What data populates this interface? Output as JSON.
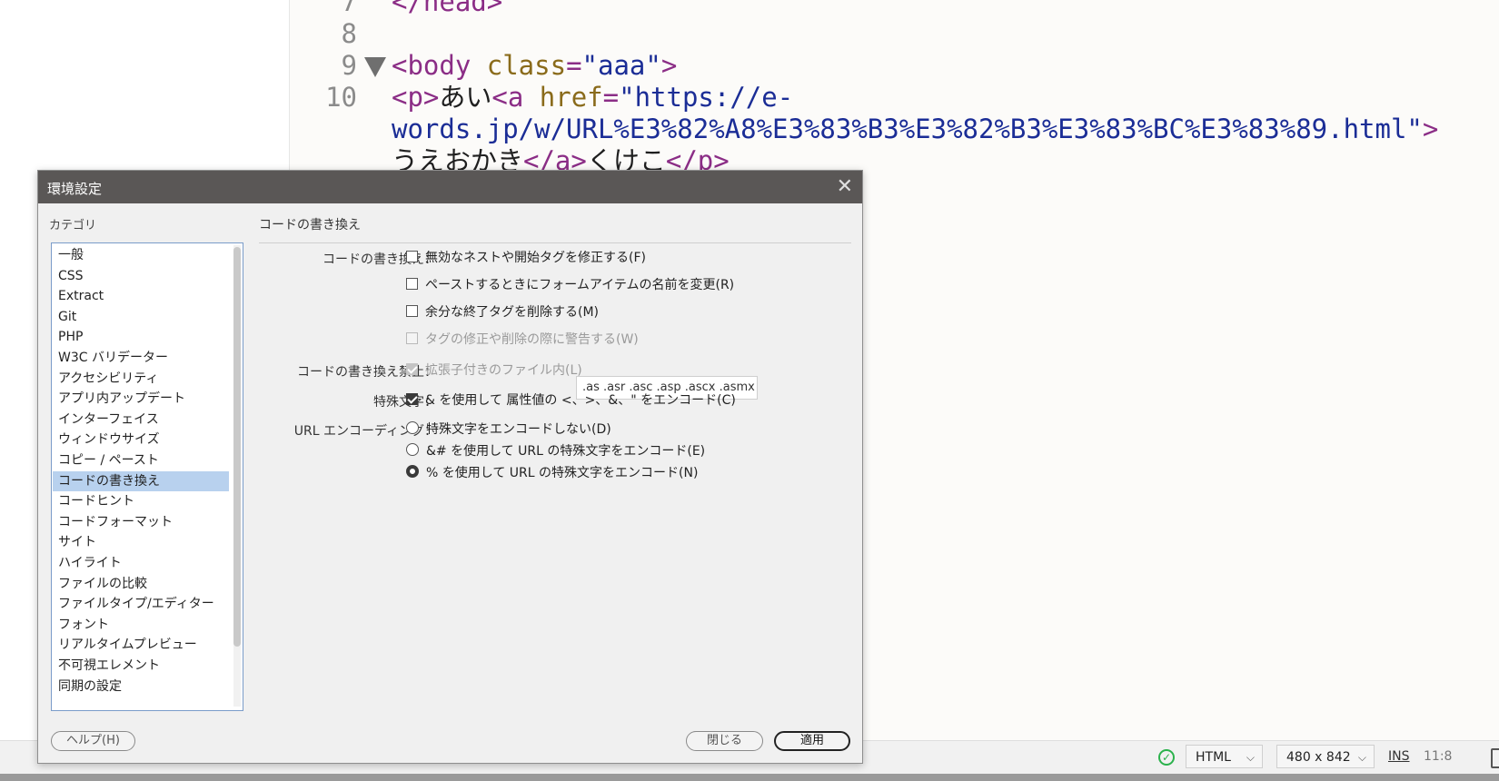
{
  "editor": {
    "lines": [
      {
        "num": "7",
        "parts": [
          [
            "tg",
            "</head>"
          ]
        ]
      },
      {
        "num": "8",
        "parts": []
      },
      {
        "num": "9",
        "parts": [
          [
            "tg",
            "<body "
          ],
          [
            "at",
            "class"
          ],
          [
            "tg",
            "="
          ],
          [
            "vl",
            "\"aaa\""
          ],
          [
            "tg",
            ">"
          ]
        ]
      },
      {
        "num": "10",
        "parts": [
          [
            "tg",
            "<p>"
          ],
          [
            "tx",
            "あい"
          ],
          [
            "tg",
            "<a "
          ],
          [
            "at",
            "href"
          ],
          [
            "tg",
            "="
          ],
          [
            "vl",
            "\"https://e-"
          ]
        ]
      },
      {
        "num": "",
        "parts": [
          [
            "vl",
            "words.jp/w/URL%E3%82%A8%E3%83%B3%E3%82%B3%E3%83%BC%E3%83%89.html\""
          ],
          [
            "tg",
            ">"
          ]
        ]
      },
      {
        "num": "",
        "parts": [
          [
            "tx",
            "うえおかき"
          ],
          [
            "tg",
            "</a>"
          ],
          [
            "tx",
            "くけこ"
          ],
          [
            "tg",
            "</p>"
          ]
        ]
      }
    ]
  },
  "dialog": {
    "title": "環境設定",
    "close_glyph": "✕",
    "category_label": "カテゴリ",
    "categories": [
      "一般",
      "CSS",
      "Extract",
      "Git",
      "PHP",
      "W3C バリデーター",
      "アクセシビリティ",
      "アプリ内アップデート",
      "インターフェイス",
      "ウィンドウサイズ",
      "コピー / ペースト",
      "コードの書き換え",
      "コードヒント",
      "コードフォーマット",
      "サイト",
      "ハイライト",
      "ファイルの比較",
      "ファイルタイプ/エディター",
      "フォント",
      "リアルタイムプレビュー",
      "不可視エレメント",
      "同期の設定"
    ],
    "selected_category": "コードの書き換え",
    "section_title": "コードの書き換え",
    "rewrite_label": "コードの書き換え：",
    "opt_fix_nesting": "無効なネストや開始タグを修正する(F)",
    "opt_rename_form": "ペーストするときにフォームアイテムの名前を変更(R)",
    "opt_remove_close": "余分な終了タグを削除する(M)",
    "opt_warn": "タグの修正や削除の際に警告する(W)",
    "never_rewrite_label": "コードの書き換え禁止：",
    "opt_ext_files": "拡張子付きのファイル内(L)",
    "ext_value": ".as .asr .asc .asp .ascx .asmx .a",
    "special_chars_label": "特殊文字：",
    "opt_encode_special": "& を使用して 属性値の <、>、&、\" をエンコード(C)",
    "url_encoding_label": "URL エンコーディング：",
    "radio_no_encode": "特殊文字をエンコードしない(D)",
    "radio_amp_encode": "&# を使用して URL の特殊文字をエンコード(E)",
    "radio_pct_encode": "% を使用して URL の特殊文字をエンコード(N)",
    "help_button": "ヘルプ(H)",
    "close_button": "閉じる",
    "apply_button": "適用"
  },
  "statusbar": {
    "doc_type": "HTML",
    "size": "480 x 842",
    "mode": "INS",
    "position": "11:8",
    "ok_glyph": "✓",
    "chevron": "⌵"
  }
}
